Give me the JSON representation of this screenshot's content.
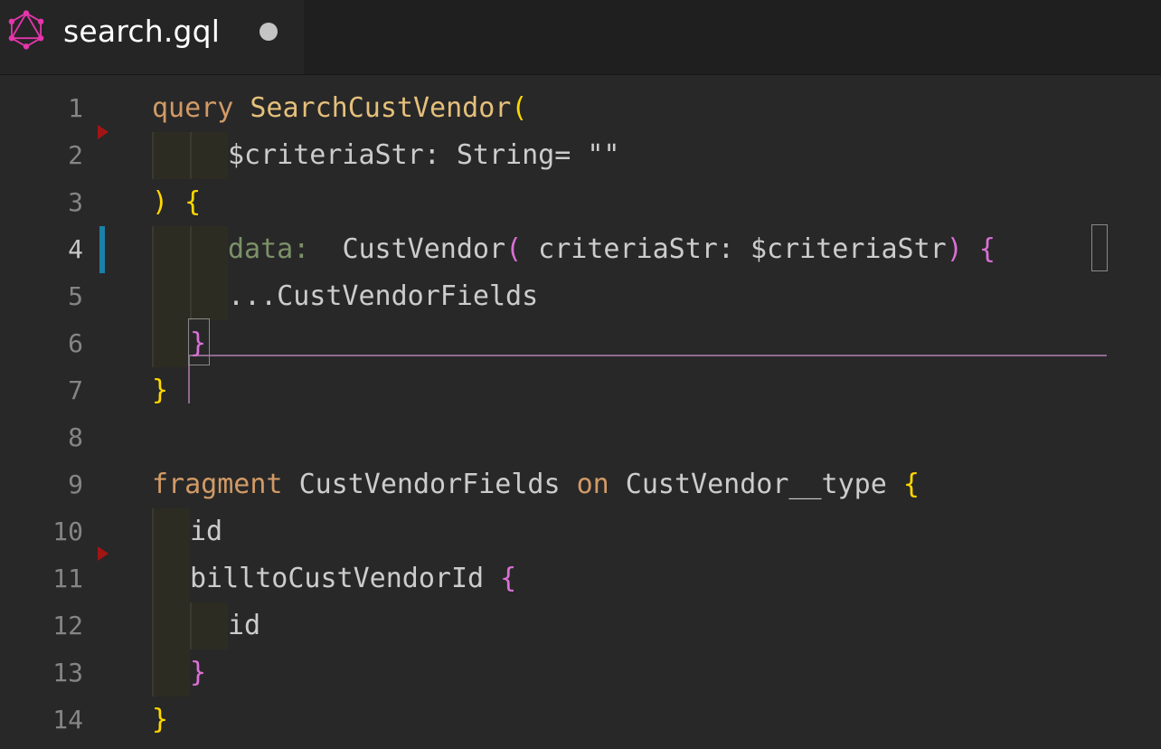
{
  "tab": {
    "title": "search.gql",
    "icon": "graphql-icon",
    "unsaved_indicator": "dirty-dot-icon"
  },
  "editor": {
    "line_numbers": [
      "1",
      "2",
      "3",
      "4",
      "5",
      "6",
      "7",
      "8",
      "9",
      "10",
      "11",
      "12",
      "13",
      "14"
    ],
    "active_line": 4,
    "lines": {
      "l1": {
        "kw": "query",
        "name": "SearchCustVendor",
        "paren": "("
      },
      "l2": {
        "text": "$criteriaStr: String= \"\""
      },
      "l3": {
        "paren": ")",
        "brace": "{"
      },
      "l4": {
        "alias": "data:",
        "field": "CustVendor",
        "paren_open": "(",
        "args": " criteriaStr: $criteriaStr",
        "paren_close": ")",
        "brace": "{"
      },
      "l5": {
        "text": "...CustVendorFields"
      },
      "l6": {
        "brace": "}"
      },
      "l7": {
        "brace": "}"
      },
      "l9": {
        "kw": "fragment",
        "name": "CustVendorFields",
        "on": "on",
        "type": "CustVendor__type",
        "brace": "{"
      },
      "l10": {
        "text": "id"
      },
      "l11": {
        "text": "billtoCustVendorId",
        "brace": "{"
      },
      "l12": {
        "text": "id"
      },
      "l13": {
        "brace": "}"
      },
      "l14": {
        "brace": "}"
      }
    }
  },
  "colors": {
    "background": "#282828",
    "keyword": "#d19a66",
    "operation_name": "#e5c07b",
    "bracket_level1": "#ffd700",
    "bracket_level2": "#da70d6",
    "modified_bar": "#1b81a8",
    "graphql_pink": "#e535ab"
  }
}
